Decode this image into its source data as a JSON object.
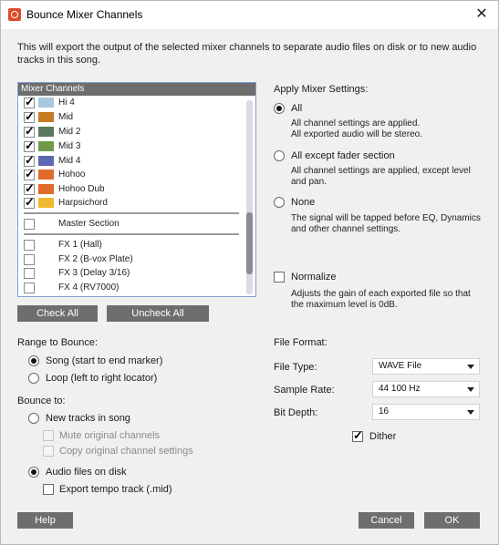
{
  "window": {
    "title": "Bounce Mixer Channels",
    "close_glyph": "✕"
  },
  "description": "This will export the output of the selected mixer channels to separate audio files on disk or to new audio tracks in this song.",
  "channels": {
    "header": "Mixer Channels",
    "items": [
      {
        "label": "Hi 4",
        "checked": true,
        "color": "#a8c8e0"
      },
      {
        "label": "Mid",
        "checked": true,
        "color": "#c87a22"
      },
      {
        "label": "Mid 2",
        "checked": true,
        "color": "#5e7a5e"
      },
      {
        "label": "Mid 3",
        "checked": true,
        "color": "#6f9a4a"
      },
      {
        "label": "Mid 4",
        "checked": true,
        "color": "#5b67b0"
      },
      {
        "label": "Hohoo",
        "checked": true,
        "color": "#e06a2a"
      },
      {
        "label": "Hohoo Dub",
        "checked": true,
        "color": "#e06a2a"
      },
      {
        "label": "Harpsichord",
        "checked": true,
        "color": "#f0b830"
      }
    ],
    "master": {
      "label": "Master Section",
      "checked": false
    },
    "fx": [
      {
        "label": "FX 1 (Hall)",
        "checked": false
      },
      {
        "label": "FX 2 (B-vox Plate)",
        "checked": false
      },
      {
        "label": "FX 3 (Delay 3/16)",
        "checked": false
      },
      {
        "label": "FX 4 (RV7000)",
        "checked": false
      }
    ],
    "check_all": "Check All",
    "uncheck_all": "Uncheck All"
  },
  "apply": {
    "title": "Apply Mixer Settings:",
    "options": [
      {
        "label": "All",
        "selected": true,
        "desc1": "All channel settings are applied.",
        "desc2": "All exported audio will be stereo."
      },
      {
        "label": "All except fader section",
        "selected": false,
        "desc1": "All channel settings are applied, except level",
        "desc2": "and pan."
      },
      {
        "label": "None",
        "selected": false,
        "desc1": "The signal will be tapped before EQ, Dynamics",
        "desc2": "and other channel settings."
      }
    ]
  },
  "normalize": {
    "label": "Normalize",
    "checked": false,
    "desc1": "Adjusts the gain of each exported file so that",
    "desc2": "the maximum level is 0dB."
  },
  "range": {
    "title": "Range to Bounce:",
    "song": "Song (start to end marker)",
    "loop": "Loop (left to right locator)",
    "selected": "song"
  },
  "bounce_to": {
    "title": "Bounce to:",
    "new_tracks": "New tracks in song",
    "mute_original": "Mute original channels",
    "copy_settings": "Copy original channel settings",
    "audio_files": "Audio files on disk",
    "export_tempo": "Export tempo track (.mid)",
    "selected": "audio_files"
  },
  "format": {
    "title": "File Format:",
    "file_type_label": "File Type:",
    "file_type": "WAVE File",
    "sample_rate_label": "Sample Rate:",
    "sample_rate": "44 100 Hz",
    "bit_depth_label": "Bit Depth:",
    "bit_depth": "16",
    "dither_label": "Dither",
    "dither": true
  },
  "footer": {
    "help": "Help",
    "cancel": "Cancel",
    "ok": "OK"
  }
}
